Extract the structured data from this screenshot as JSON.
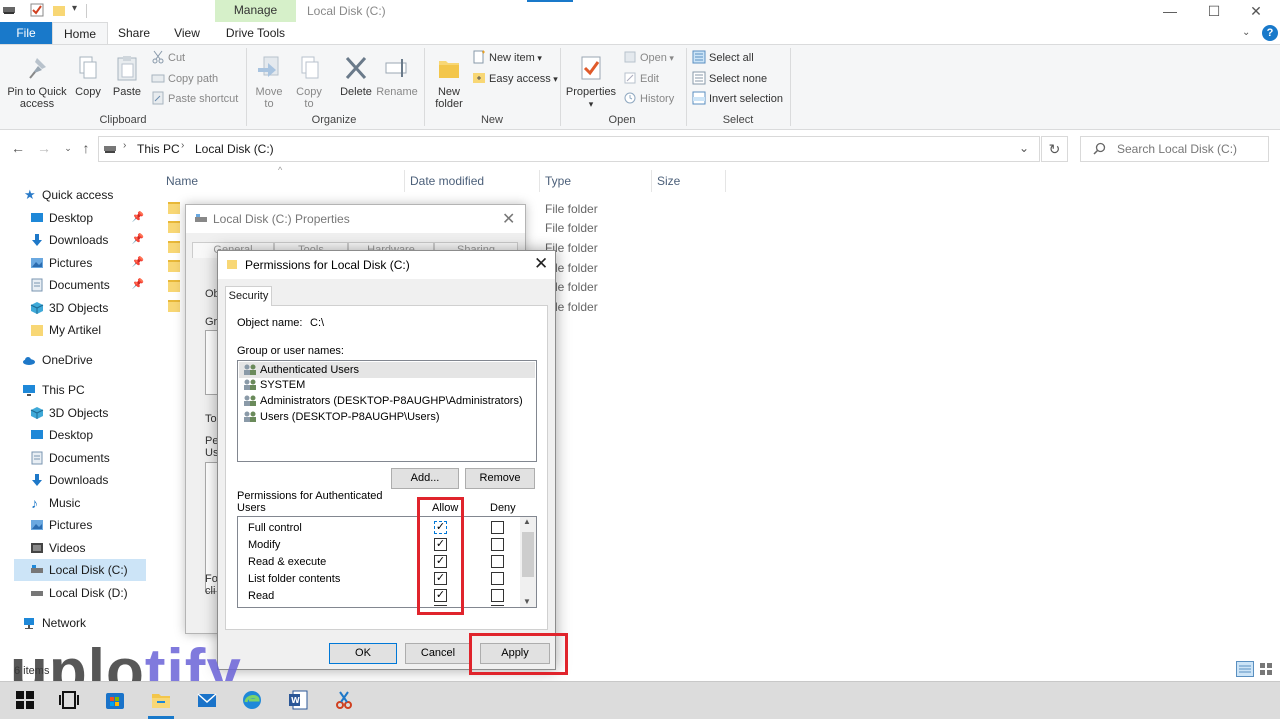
{
  "window": {
    "title": "Local Disk (C:)",
    "contextual_tab_group": "Manage",
    "controls": {
      "minimize": "—",
      "maximize": "☐",
      "close": "✕"
    }
  },
  "ribbon": {
    "tabs": {
      "file": "File",
      "home": "Home",
      "share": "Share",
      "view": "View",
      "drive_tools": "Drive Tools"
    },
    "help": "?",
    "clipboard": {
      "label": "Clipboard",
      "pin": "Pin to Quick access",
      "copy": "Copy",
      "paste": "Paste",
      "cut": "Cut",
      "copy_path": "Copy path",
      "paste_shortcut": "Paste shortcut"
    },
    "organize": {
      "label": "Organize",
      "move_to": "Move to",
      "copy_to": "Copy to",
      "delete": "Delete",
      "rename": "Rename"
    },
    "new": {
      "label": "New",
      "new_folder": "New folder",
      "new_item": "New item",
      "easy_access": "Easy access"
    },
    "open": {
      "label": "Open",
      "properties": "Properties",
      "open": "Open",
      "edit": "Edit",
      "history": "History"
    },
    "select": {
      "label": "Select",
      "select_all": "Select all",
      "select_none": "Select none",
      "invert": "Invert selection"
    }
  },
  "address_bar": {
    "crumbs": [
      "This PC",
      "Local Disk (C:)"
    ],
    "search_placeholder": "Search Local Disk (C:)"
  },
  "nav_pane": {
    "quick_access": "Quick access",
    "quick_items": [
      "Desktop",
      "Downloads",
      "Pictures",
      "Documents",
      "3D Objects",
      "My Artikel"
    ],
    "onedrive": "OneDrive",
    "this_pc": "This PC",
    "pc_items": [
      "3D Objects",
      "Desktop",
      "Documents",
      "Downloads",
      "Music",
      "Pictures",
      "Videos",
      "Local Disk (C:)",
      "Local Disk (D:)"
    ],
    "network": "Network"
  },
  "file_list": {
    "columns": [
      "Name",
      "Date modified",
      "Type",
      "Size"
    ],
    "types": [
      "File folder",
      "File folder",
      "File folder",
      "File folder",
      "File folder",
      "File folder"
    ]
  },
  "properties_dialog": {
    "title": "Local Disk (C:) Properties",
    "tabs": [
      "General",
      "Tools",
      "Hardware",
      "Sharing"
    ],
    "fragments": {
      "ob": "Ob",
      "gr": "Gr",
      "to": "To",
      "pe": "Pe",
      "us": "Us",
      "fo": "Fo",
      "cli": "cli"
    }
  },
  "permissions_dialog": {
    "title": "Permissions for Local Disk (C:)",
    "tab": "Security",
    "object_name_label": "Object name:",
    "object_name_value": "C:\\",
    "group_label": "Group or user names:",
    "users": [
      "Authenticated Users",
      "SYSTEM",
      "Administrators (DESKTOP-P8AUGHP\\Administrators)",
      "Users (DESKTOP-P8AUGHP\\Users)"
    ],
    "add_button": "Add...",
    "remove_button": "Remove",
    "permissions_label_line1": "Permissions for Authenticated",
    "permissions_label_line2": "Users",
    "allow_header": "Allow",
    "deny_header": "Deny",
    "permissions": [
      {
        "name": "Full control",
        "allow": true,
        "deny": false
      },
      {
        "name": "Modify",
        "allow": true,
        "deny": false
      },
      {
        "name": "Read & execute",
        "allow": true,
        "deny": false
      },
      {
        "name": "List folder contents",
        "allow": true,
        "deny": false
      },
      {
        "name": "Read",
        "allow": true,
        "deny": false
      }
    ],
    "ok_button": "OK",
    "cancel_button": "Cancel",
    "apply_button": "Apply"
  },
  "status_bar": {
    "items": "6 items"
  },
  "watermark": {
    "prefix": "uplo",
    "accent": "tify"
  },
  "colors": {
    "accent": "#1979ca",
    "highlight": "#e0242c",
    "manage_tab": "#d6f0c9"
  }
}
